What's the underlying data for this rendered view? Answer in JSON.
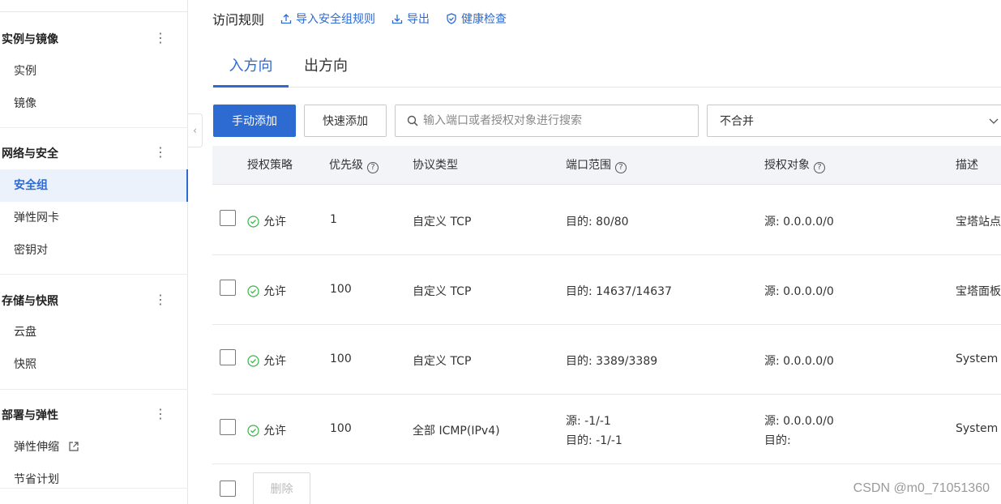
{
  "sidebar": {
    "groups": [
      {
        "title": "实例与镜像",
        "items": [
          "实例",
          "镜像"
        ]
      },
      {
        "title": "网络与安全",
        "items": [
          "安全组",
          "弹性网卡",
          "密钥对"
        ]
      },
      {
        "title": "存储与快照",
        "items": [
          "云盘",
          "快照"
        ]
      },
      {
        "title": "部署与弹性",
        "items": [
          "弹性伸缩",
          "节省计划"
        ]
      }
    ],
    "active_item": "安全组",
    "more_glyph": "⋮",
    "collapse_glyph": "‹"
  },
  "header": {
    "title": "访问规则",
    "actions": [
      "导入安全组规则",
      "导出",
      "健康检查"
    ]
  },
  "tabs": [
    "入方向",
    "出方向"
  ],
  "active_tab": "入方向",
  "toolbar": {
    "manual_add": "手动添加",
    "quick_add": "快速添加",
    "search_placeholder": "输入端口或者授权对象进行搜索",
    "merge_select": "不合并"
  },
  "table": {
    "columns": [
      "授权策略",
      "优先级",
      "协议类型",
      "端口范围",
      "授权对象",
      "描述"
    ],
    "help_glyph": "?",
    "rows": [
      {
        "policy": "允许",
        "priority": "1",
        "protocol": "自定义 TCP",
        "port": [
          "目的: 80/80"
        ],
        "object": [
          "源: 0.0.0.0/0"
        ],
        "desc": "宝塔站点"
      },
      {
        "policy": "允许",
        "priority": "100",
        "protocol": "自定义 TCP",
        "port": [
          "目的: 14637/14637"
        ],
        "object": [
          "源: 0.0.0.0/0"
        ],
        "desc": "宝塔面板"
      },
      {
        "policy": "允许",
        "priority": "100",
        "protocol": "自定义 TCP",
        "port": [
          "目的: 3389/3389"
        ],
        "object": [
          "源: 0.0.0.0/0"
        ],
        "desc": "System c"
      },
      {
        "policy": "允许",
        "priority": "100",
        "protocol": "全部 ICMP(IPv4)",
        "port": [
          "源: -1/-1",
          "目的: -1/-1"
        ],
        "object": [
          "源: 0.0.0.0/0",
          "目的:"
        ],
        "desc": "System c"
      }
    ]
  },
  "footer": {
    "delete": "删除"
  },
  "watermark": "CSDN @m0_71051360",
  "colors": {
    "accent": "#2d6ad1",
    "allow_green": "#3bb34a"
  }
}
